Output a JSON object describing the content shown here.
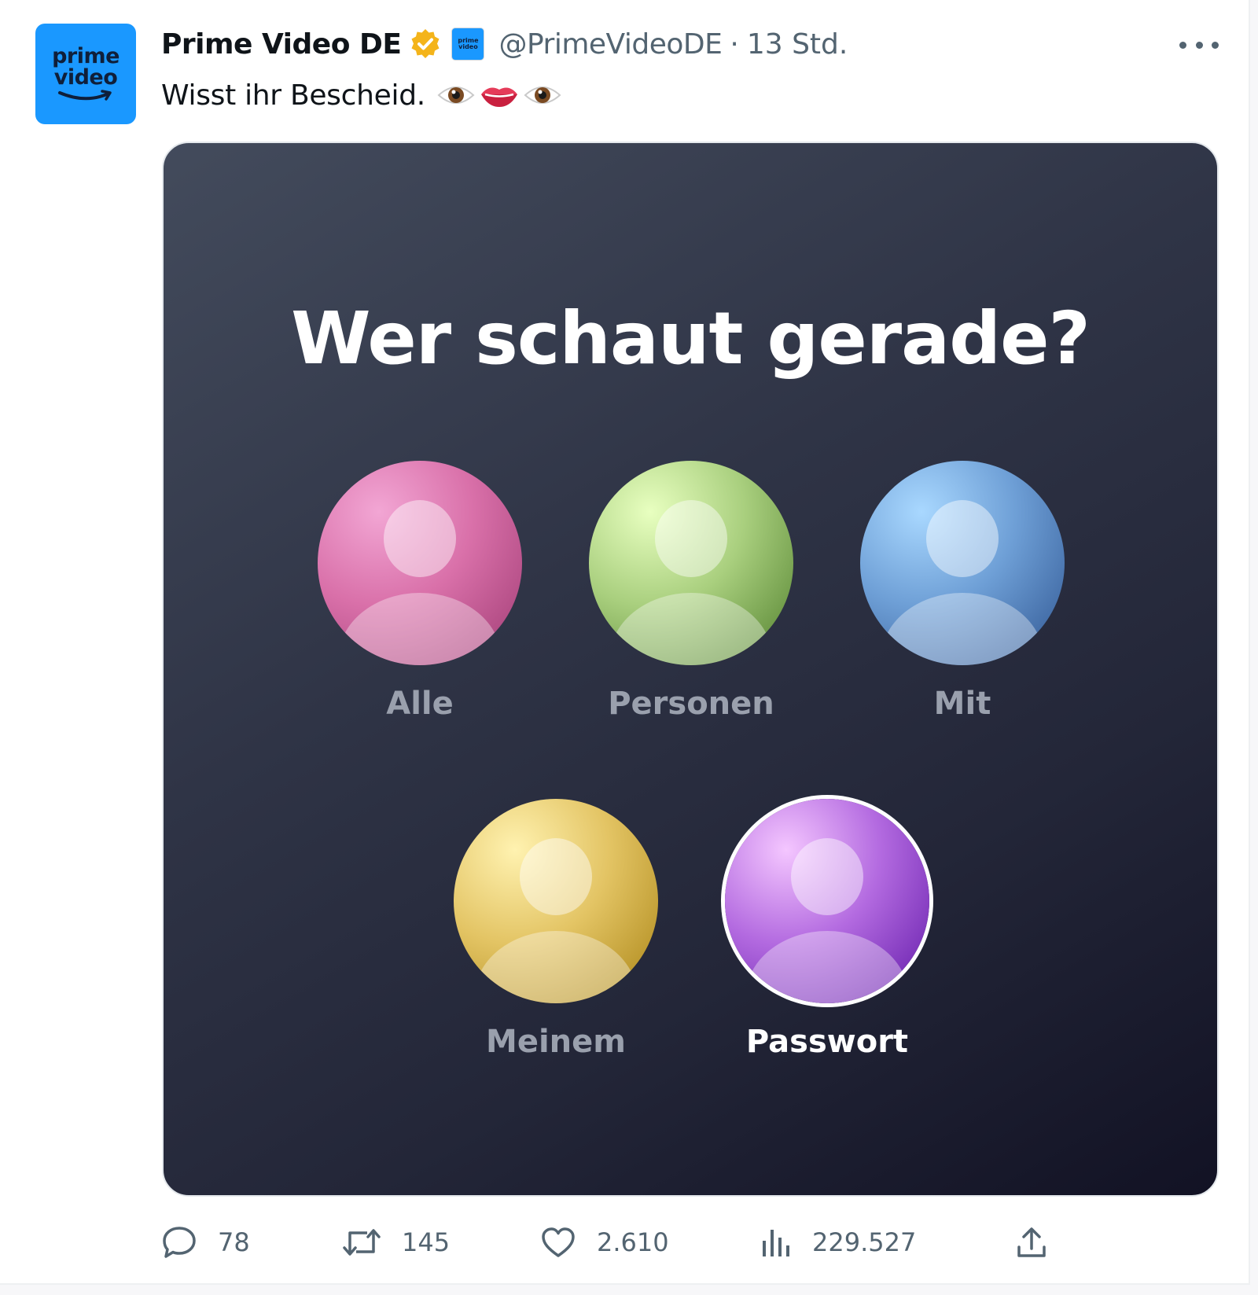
{
  "account": {
    "avatar_line1": "prime",
    "avatar_line2": "video",
    "display_name": "Prime Video DE",
    "badge_line1": "prime",
    "badge_line2": "video",
    "handle": "@PrimeVideoDE",
    "separator": "·",
    "time": "13 Std."
  },
  "tweet": {
    "text": "Wisst ihr Bescheid.",
    "emojis": [
      "eye-emoji",
      "lips-emoji",
      "eye-emoji"
    ]
  },
  "media": {
    "title": "Wer schaut gerade?",
    "profiles": [
      {
        "label": "Alle",
        "color": "#d970a9"
      },
      {
        "label": "Personen",
        "color": "#a9cf7e"
      },
      {
        "label": "Mit",
        "color": "#6e9fd6"
      },
      {
        "label": "Meinem",
        "color": "#e3c464"
      },
      {
        "label": "Passwort",
        "color": "#b36ae0",
        "selected": true
      }
    ]
  },
  "actions": {
    "replies": "78",
    "reposts": "145",
    "likes": "2.610",
    "views": "229.527",
    "share_icon": "share-icon"
  },
  "colors": {
    "brand": "#1a98ff",
    "verified": "#f4b41a",
    "secondary_text": "#536471"
  }
}
